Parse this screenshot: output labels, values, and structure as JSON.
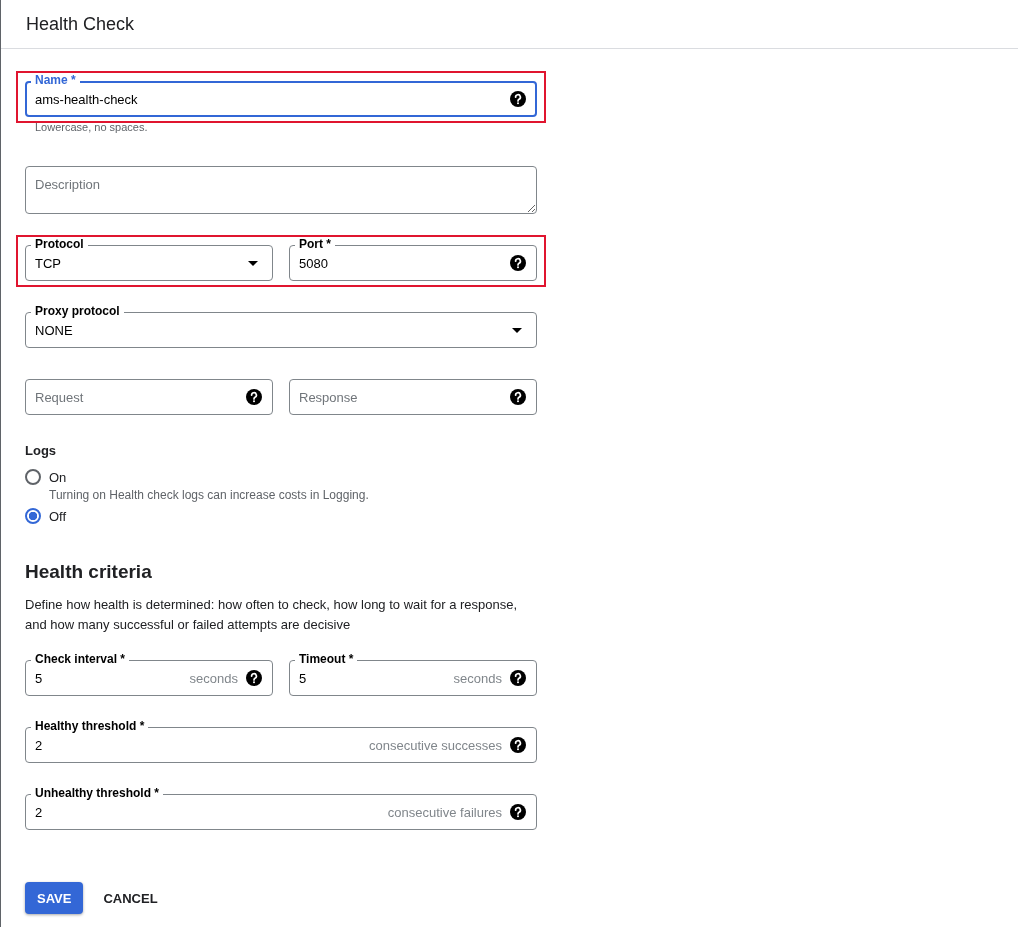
{
  "header": {
    "title": "Health Check"
  },
  "fields_top": [
    {
      "highlighted": true,
      "hint": "Lowercase, no spaces.",
      "fields": [
        {
          "kind": "text",
          "label": "Name *",
          "value": "ams-health-check",
          "focused": true,
          "help": true
        }
      ]
    },
    {
      "highlighted": false,
      "fields": [
        {
          "kind": "textarea",
          "placeholder": "Description"
        }
      ]
    },
    {
      "highlighted": true,
      "fields": [
        {
          "kind": "select",
          "label": "Protocol",
          "value": "TCP"
        },
        {
          "kind": "text",
          "label": "Port *",
          "value": "5080",
          "help": true
        }
      ]
    },
    {
      "highlighted": false,
      "fields": [
        {
          "kind": "select",
          "label": "Proxy protocol",
          "value": "NONE"
        }
      ]
    },
    {
      "highlighted": false,
      "fields": [
        {
          "kind": "text",
          "placeholder": "Request",
          "help": true
        },
        {
          "kind": "text",
          "placeholder": "Response",
          "help": true
        }
      ]
    }
  ],
  "logs": {
    "label": "Logs",
    "options": [
      {
        "label": "On",
        "selected": false,
        "note": "Turning on Health check logs can increase costs in Logging."
      },
      {
        "label": "Off",
        "selected": true
      }
    ]
  },
  "health_criteria": {
    "title": "Health criteria",
    "description": "Define how health is determined: how often to check, how long to wait for a response, and how many successful or failed attempts are decisive",
    "rows": [
      {
        "highlighted": false,
        "fields": [
          {
            "kind": "text",
            "label": "Check interval *",
            "value": "5",
            "suffix": "seconds",
            "help": true
          },
          {
            "kind": "text",
            "label": "Timeout *",
            "value": "5",
            "suffix": "seconds",
            "help": true
          }
        ]
      },
      {
        "highlighted": false,
        "fields": [
          {
            "kind": "text",
            "label": "Healthy threshold *",
            "value": "2",
            "suffix": "consecutive successes",
            "help": true
          }
        ]
      },
      {
        "highlighted": false,
        "fields": [
          {
            "kind": "text",
            "label": "Unhealthy threshold *",
            "value": "2",
            "suffix": "consecutive failures",
            "help": true
          }
        ]
      }
    ]
  },
  "buttons": [
    {
      "label": "SAVE",
      "kind": "primary"
    },
    {
      "label": "CANCEL",
      "kind": "text"
    }
  ]
}
